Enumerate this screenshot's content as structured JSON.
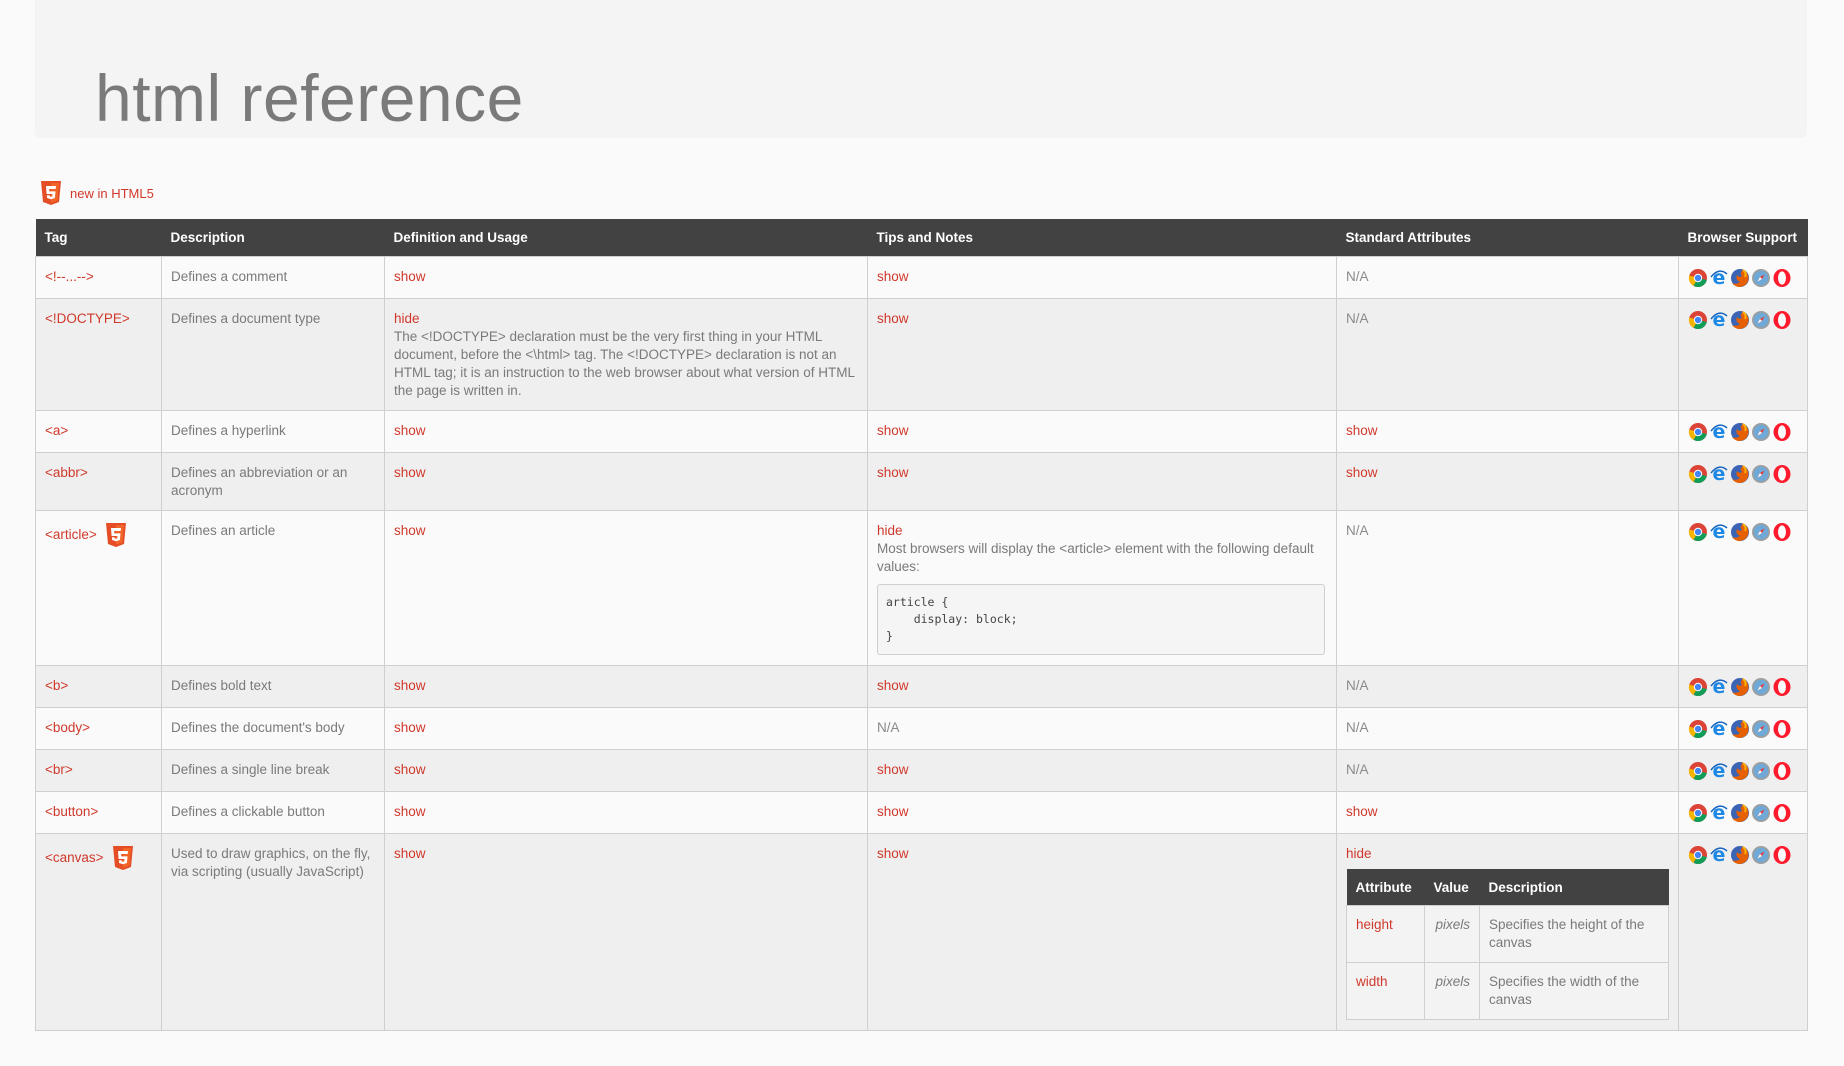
{
  "page": {
    "title": "html reference"
  },
  "legend": {
    "label": "new in HTML5"
  },
  "colors": {
    "accent": "#d0382b",
    "header_bg": "#424242"
  },
  "table": {
    "headers": [
      "Tag",
      "Description",
      "Definition and Usage",
      "Tips and Notes",
      "Standard Attributes",
      "Browser Support"
    ],
    "rows": [
      {
        "tag": "<!--...-->",
        "html5": false,
        "description": "Defines a comment",
        "definition": "show",
        "tips": "show",
        "attributes": "N/A"
      },
      {
        "tag": "<!DOCTYPE>",
        "html5": false,
        "description": "Defines a document type",
        "definition": "hide",
        "definition_text": "The <!DOCTYPE> declaration must be the very first thing in your HTML document, before the <\\html> tag. The <!DOCTYPE> declaration is not an HTML tag; it is an instruction to the web browser about what version of HTML the page is written in.",
        "tips": "show",
        "attributes": "N/A"
      },
      {
        "tag": "<a>",
        "html5": false,
        "description": "Defines a hyperlink",
        "definition": "show",
        "tips": "show",
        "attributes": "show"
      },
      {
        "tag": "<abbr>",
        "html5": false,
        "description": "Defines an abbreviation or an acronym",
        "definition": "show",
        "tips": "show",
        "attributes": "show"
      },
      {
        "tag": "<article>",
        "html5": true,
        "description": "Defines an article",
        "definition": "show",
        "tips": "hide",
        "tips_text": "Most browsers will display the <article> element with the following default values:",
        "tips_code": "article {\n    display: block;\n}",
        "attributes": "N/A"
      },
      {
        "tag": "<b>",
        "html5": false,
        "description": "Defines bold text",
        "definition": "show",
        "tips": "show",
        "attributes": "N/A"
      },
      {
        "tag": "<body>",
        "html5": false,
        "description": "Defines the document's body",
        "definition": "show",
        "tips": "N/A",
        "attributes": "N/A"
      },
      {
        "tag": "<br>",
        "html5": false,
        "description": "Defines a single line break",
        "definition": "show",
        "tips": "show",
        "attributes": "N/A"
      },
      {
        "tag": "<button>",
        "html5": false,
        "description": "Defines a clickable button",
        "definition": "show",
        "tips": "show",
        "attributes": "show"
      },
      {
        "tag": "<canvas>",
        "html5": true,
        "description": "Used to draw graphics, on the fly, via scripting (usually JavaScript)",
        "definition": "show",
        "tips": "show",
        "attributes": "hide"
      }
    ],
    "canvas_attributes": {
      "headers": [
        "Attribute",
        "Value",
        "Description"
      ],
      "rows": [
        {
          "name": "height",
          "value": "pixels",
          "description": "Specifies the height of the canvas"
        },
        {
          "name": "width",
          "value": "pixels",
          "description": "Specifies the width of the canvas"
        }
      ]
    },
    "browser_icons": [
      "chrome-icon",
      "ie-icon",
      "firefox-icon",
      "safari-icon",
      "opera-icon"
    ]
  }
}
